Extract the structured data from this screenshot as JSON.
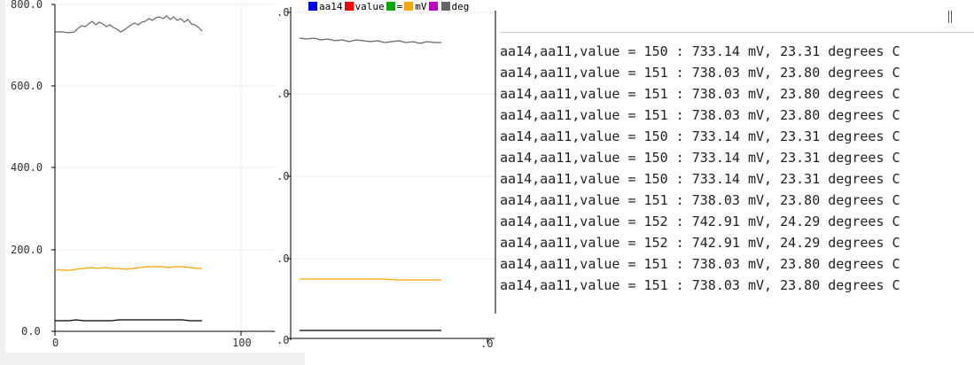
{
  "plot_left": {
    "y_ticks": [
      "800.0",
      "600.0",
      "400.0",
      "200.0",
      "0.0"
    ],
    "x_ticks": [
      "0",
      "100"
    ]
  },
  "plot_mid": {
    "y_ticks": [
      ".0",
      ".0",
      ".0",
      ".0",
      ".0"
    ],
    "x_ticks": [
      ".0"
    ]
  },
  "legend": [
    {
      "label": "aa14",
      "color": "#0000ff"
    },
    {
      "label": "value",
      "color": "#ff0000"
    },
    {
      "label": "=",
      "color": "#00aa00"
    },
    {
      "label": "mV",
      "color": "#ffa500"
    },
    {
      "label": "",
      "color": "#c000c0"
    },
    {
      "label": "deg",
      "color": "#666666"
    }
  ],
  "colors": {
    "top_series": "#666666",
    "mid_series": "#ffa500",
    "low_series": "#000000"
  },
  "serial_monitor": {
    "lines": [
      "aa14,aa11,value = 150 : 733.14 mV, 23.31 degrees C",
      "aa14,aa11,value = 151 : 738.03 mV, 23.80 degrees C",
      "aa14,aa11,value = 151 : 738.03 mV, 23.80 degrees C",
      "aa14,aa11,value = 151 : 738.03 mV, 23.80 degrees C",
      "aa14,aa11,value = 150 : 733.14 mV, 23.31 degrees C",
      "aa14,aa11,value = 150 : 733.14 mV, 23.31 degrees C",
      "aa14,aa11,value = 150 : 733.14 mV, 23.31 degrees C",
      "aa14,aa11,value = 151 : 738.03 mV, 23.80 degrees C",
      "aa14,aa11,value = 152 : 742.91 mV, 24.29 degrees C",
      "aa14,aa11,value = 152 : 742.91 mV, 24.29 degrees C",
      "aa14,aa11,value = 151 : 738.03 mV, 23.80 degrees C",
      "aa14,aa11,value = 151 : 738.03 mV, 23.80 degrees C"
    ]
  }
}
